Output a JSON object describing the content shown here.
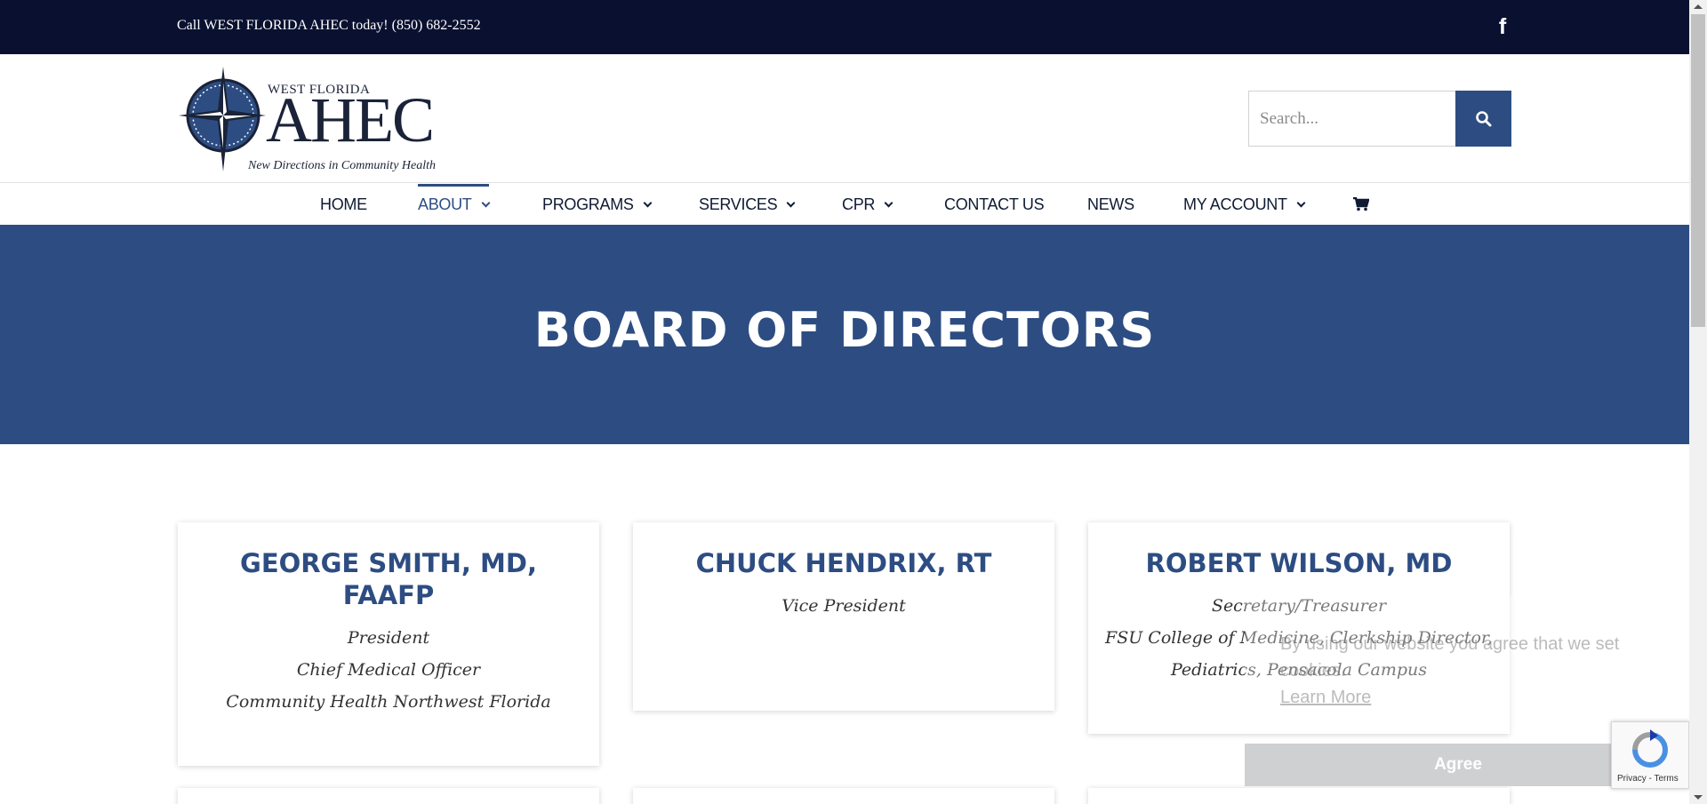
{
  "topbar": {
    "phone_text": "Call WEST FLORIDA AHEC today! (850) 682-2552",
    "facebook_glyph": "f"
  },
  "logo": {
    "small_text": "WEST FLORIDA",
    "big_text": "AHEC",
    "tagline": "New Directions in Community Health"
  },
  "search": {
    "placeholder": "Search..."
  },
  "nav": {
    "items": [
      {
        "label": "HOME"
      },
      {
        "label": "ABOUT"
      },
      {
        "label": "PROGRAMS"
      },
      {
        "label": "SERVICES"
      },
      {
        "label": "CPR"
      },
      {
        "label": "CONTACT US"
      },
      {
        "label": "NEWS"
      },
      {
        "label": "MY ACCOUNT"
      }
    ],
    "cart_icon": "shopping-cart-icon",
    "active_color": "#2d4d82"
  },
  "hero": {
    "title": "BOARD OF DIRECTORS"
  },
  "directors": [
    {
      "name": "GEORGE SMITH, MD, FAAFP",
      "roles": [
        "President",
        "Chief Medical Officer",
        "Community Health Northwest Florida"
      ]
    },
    {
      "name": "CHUCK HENDRIX, RT",
      "roles": [
        "Vice President"
      ]
    },
    {
      "name": "ROBERT WILSON, MD",
      "roles": [
        "Secretary/Treasurer",
        "FSU College of Medicine, Clerkship Director,",
        "Pediatrics, Pensacola Campus"
      ]
    }
  ],
  "cookie": {
    "text": "By using our website you agree that we set cookies.",
    "learn_more": "Learn More",
    "agree": "Agree"
  },
  "recaptcha": {
    "text": "Privacy - Terms"
  },
  "colors": {
    "topbar": "#0a1130",
    "brand": "#2d4d82",
    "heading": "#2d4d82"
  }
}
